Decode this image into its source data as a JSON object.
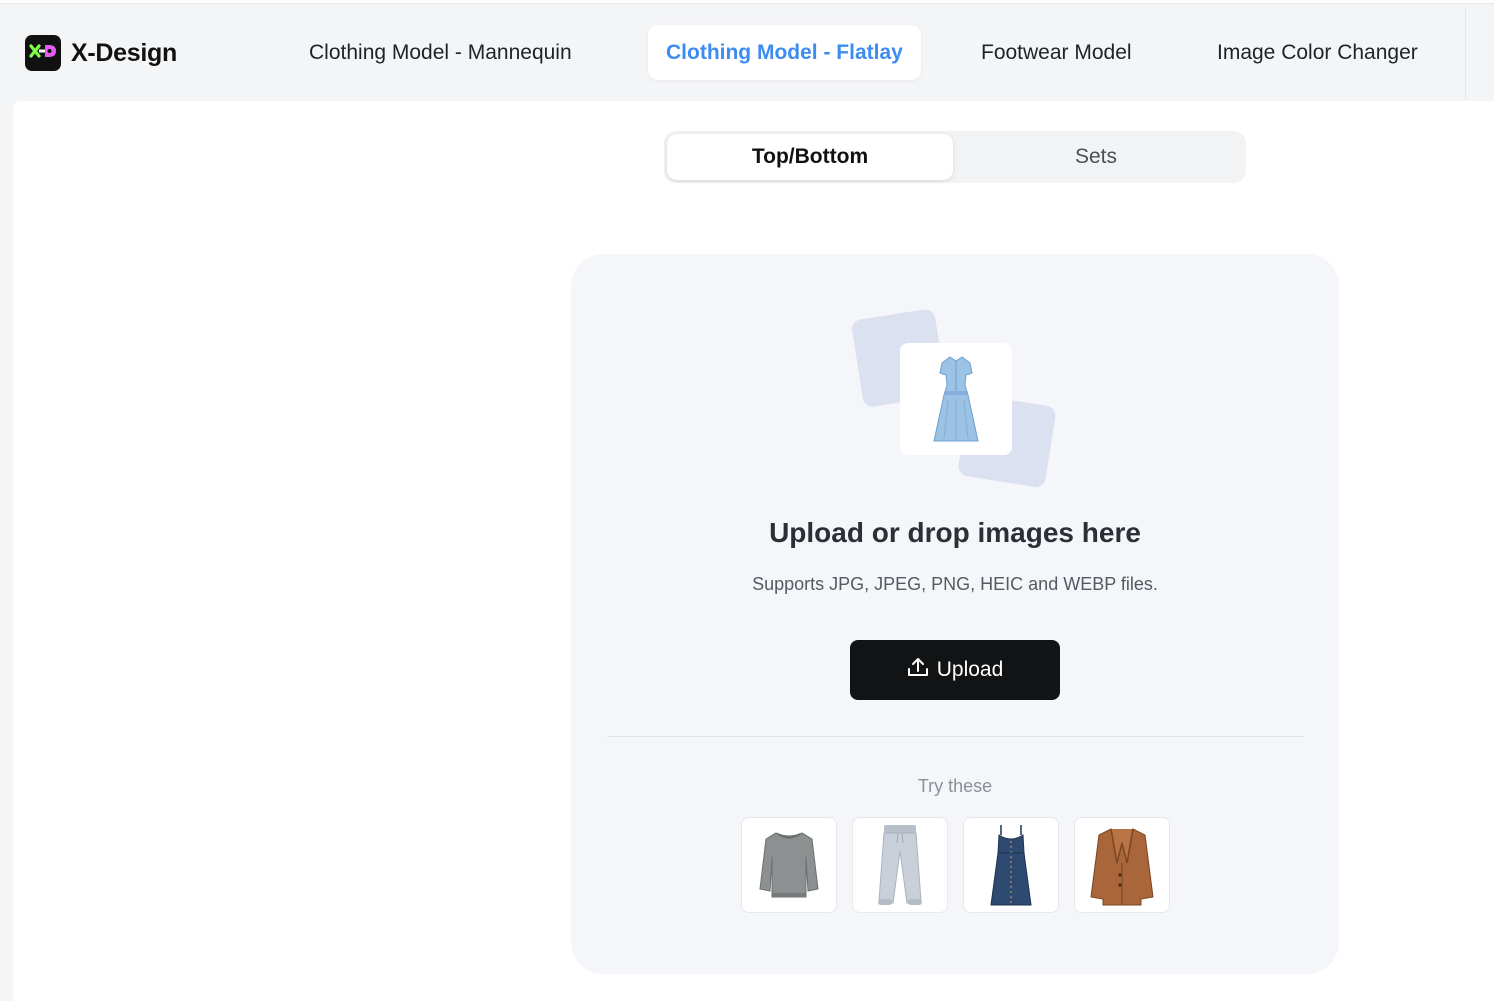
{
  "app": {
    "name": "X-Design",
    "logo_icon": "x-design-logo-icon",
    "accent_color": "#3d8cf2"
  },
  "nav": {
    "items": [
      {
        "label": "Clothing Model - Mannequin",
        "active": false
      },
      {
        "label": "Clothing Model - Flatlay",
        "active": true
      },
      {
        "label": "Footwear Model",
        "active": false
      },
      {
        "label": "Image Color Changer",
        "active": false
      }
    ]
  },
  "segment": {
    "options": [
      {
        "label": "Top/Bottom",
        "active": true
      },
      {
        "label": "Sets",
        "active": false
      }
    ]
  },
  "upload": {
    "illustration_icon": "dress-icon",
    "title": "Upload or drop images here",
    "subtitle": "Supports JPG, JPEG, PNG, HEIC and WEBP files.",
    "button_label": "Upload",
    "button_icon": "upload-icon"
  },
  "samples": {
    "label": "Try these",
    "items": [
      {
        "name": "sweater-sample"
      },
      {
        "name": "sweatpants-sample"
      },
      {
        "name": "denim-dress-sample"
      },
      {
        "name": "leather-blazer-sample"
      }
    ]
  }
}
